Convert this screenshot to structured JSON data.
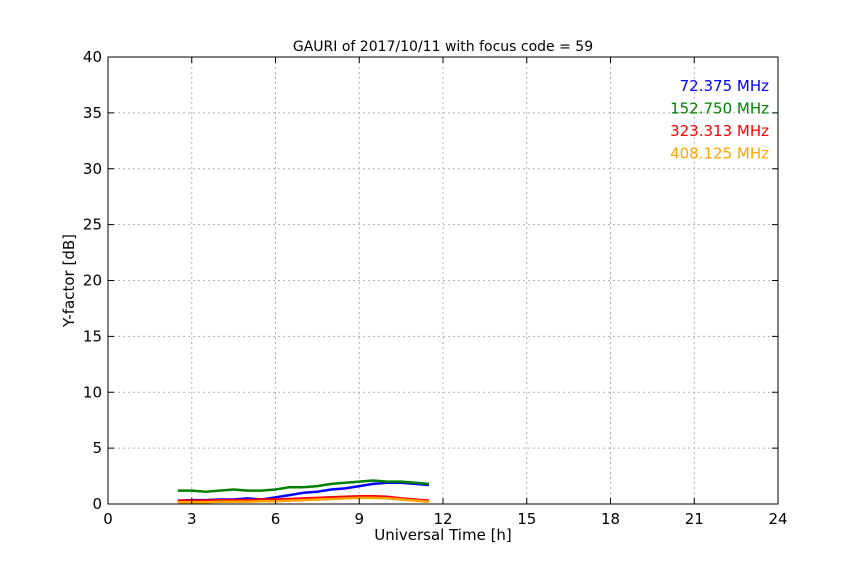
{
  "chart_data": {
    "type": "line",
    "title": "GAURI of 2017/10/11 with focus code = 59",
    "xlabel": "Universal Time [h]",
    "ylabel": "Y-factor [dB]",
    "xlim": [
      0,
      24
    ],
    "ylim": [
      0,
      40
    ],
    "xticks": [
      0,
      3,
      6,
      9,
      12,
      15,
      18,
      21,
      24
    ],
    "yticks": [
      0,
      5,
      10,
      15,
      20,
      25,
      30,
      35,
      40
    ],
    "grid": true,
    "legend_position": "top-right",
    "series": [
      {
        "name": "72.375 MHz",
        "color": "#0000ff",
        "x": [
          2.5,
          3.0,
          3.5,
          4.0,
          4.5,
          5.0,
          5.5,
          6.0,
          6.5,
          7.0,
          7.5,
          8.0,
          8.5,
          9.0,
          9.5,
          10.0,
          10.5,
          11.0,
          11.5
        ],
        "y": [
          0.3,
          0.35,
          0.35,
          0.4,
          0.4,
          0.5,
          0.4,
          0.6,
          0.8,
          1.0,
          1.1,
          1.3,
          1.4,
          1.6,
          1.8,
          1.9,
          1.9,
          1.8,
          1.7
        ]
      },
      {
        "name": "152.750 MHz",
        "color": "#008000",
        "x": [
          2.5,
          3.0,
          3.5,
          4.0,
          4.5,
          5.0,
          5.5,
          6.0,
          6.5,
          7.0,
          7.5,
          8.0,
          8.5,
          9.0,
          9.5,
          10.0,
          10.5,
          11.0,
          11.5
        ],
        "y": [
          1.2,
          1.2,
          1.1,
          1.2,
          1.3,
          1.2,
          1.2,
          1.3,
          1.5,
          1.5,
          1.6,
          1.8,
          1.9,
          2.0,
          2.1,
          2.0,
          2.0,
          1.9,
          1.8
        ]
      },
      {
        "name": "323.313 MHz",
        "color": "#ff0000",
        "x": [
          2.5,
          3.0,
          3.5,
          4.0,
          4.5,
          5.0,
          5.5,
          6.0,
          6.5,
          7.0,
          7.5,
          8.0,
          8.5,
          9.0,
          9.5,
          10.0,
          10.5,
          11.0,
          11.5
        ],
        "y": [
          0.3,
          0.3,
          0.3,
          0.35,
          0.35,
          0.35,
          0.4,
          0.4,
          0.45,
          0.5,
          0.55,
          0.6,
          0.65,
          0.7,
          0.7,
          0.65,
          0.5,
          0.4,
          0.3
        ]
      },
      {
        "name": "408.125 MHz",
        "color": "#ffa500",
        "x": [
          2.5,
          3.0,
          3.5,
          4.0,
          4.5,
          5.0,
          5.5,
          6.0,
          6.5,
          7.0,
          7.5,
          8.0,
          8.5,
          9.0,
          9.5,
          10.0,
          10.5,
          11.0,
          11.5
        ],
        "y": [
          0.15,
          0.15,
          0.15,
          0.2,
          0.2,
          0.2,
          0.25,
          0.25,
          0.3,
          0.35,
          0.4,
          0.45,
          0.5,
          0.55,
          0.55,
          0.5,
          0.4,
          0.3,
          0.2
        ]
      }
    ]
  }
}
